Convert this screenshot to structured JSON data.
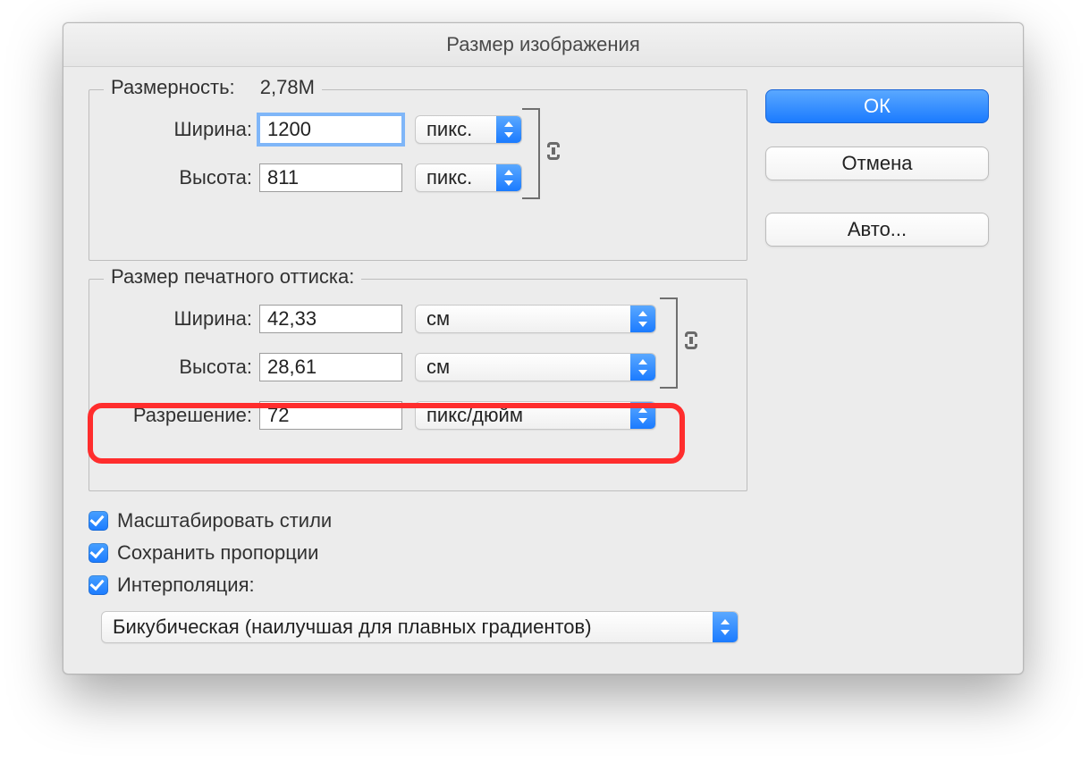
{
  "window_title": "Размер изображения",
  "buttons": {
    "ok": "ОК",
    "cancel": "Отмена",
    "auto": "Авто..."
  },
  "pixel_dimensions": {
    "legend_label": "Размерность:",
    "legend_value": "2,78М",
    "width_label": "Ширина:",
    "width_value": "1200",
    "width_unit": "пикс.",
    "height_label": "Высота:",
    "height_value": "811",
    "height_unit": "пикс."
  },
  "document_size": {
    "legend": "Размер печатного оттиска:",
    "width_label": "Ширина:",
    "width_value": "42,33",
    "width_unit": "см",
    "height_label": "Высота:",
    "height_value": "28,61",
    "height_unit": "см",
    "resolution_label": "Разрешение:",
    "resolution_value": "72",
    "resolution_unit": "пикс/дюйм"
  },
  "options": {
    "scale_styles": "Масштабировать стили",
    "constrain": "Сохранить пропорции",
    "resample": "Интерполяция:"
  },
  "resample_method": "Бикубическая (наилучшая для плавных градиентов)"
}
